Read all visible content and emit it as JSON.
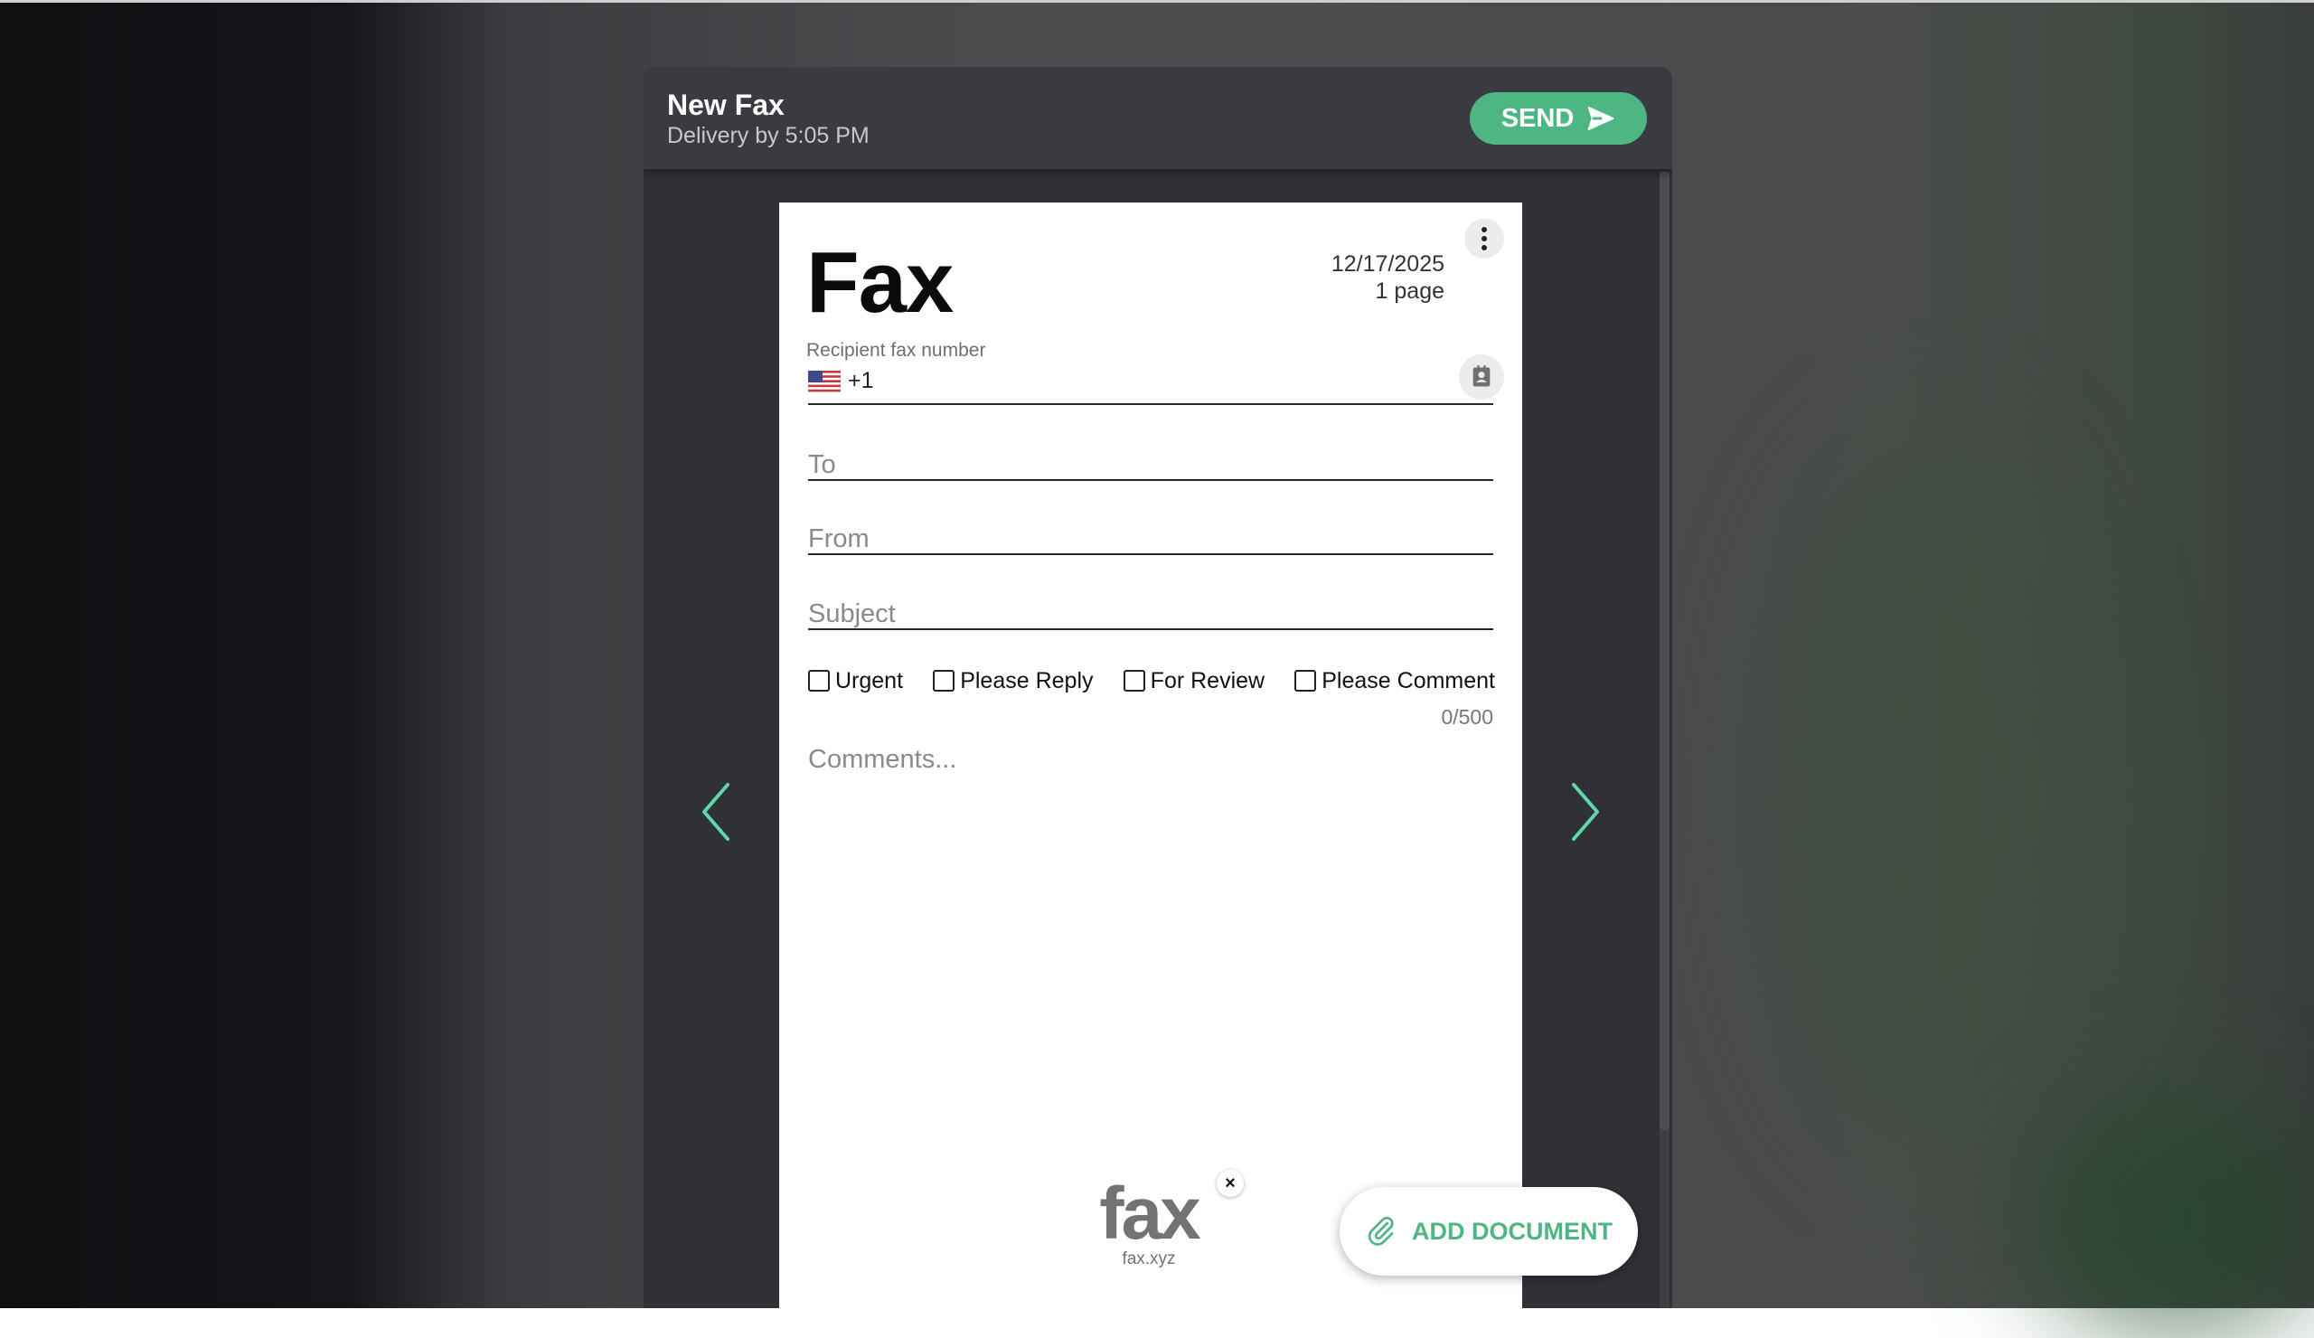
{
  "header": {
    "title": "New Fax",
    "subtitle": "Delivery by 5:05 PM",
    "send_label": "SEND"
  },
  "document": {
    "heading": "Fax",
    "date": "12/17/2025",
    "pages": "1 page",
    "recipient_label": "Recipient fax number",
    "country_code": "+1",
    "to_placeholder": "To",
    "from_placeholder": "From",
    "subject_placeholder": "Subject",
    "checkboxes": [
      "Urgent",
      "Please Reply",
      "For Review",
      "Please Comment"
    ],
    "char_counter": "0/500",
    "comments_placeholder": "Comments...",
    "logo_text": "fax",
    "logo_subtext": "fax.xyz",
    "logo_remove": "×"
  },
  "actions": {
    "add_document_label": "ADD DOCUMENT"
  },
  "colors": {
    "accent": "#4db683",
    "arrow": "#5fd6a4",
    "window_bg": "#2f3137",
    "titlebar_bg": "#393b41"
  },
  "icons": {
    "send": "send-icon",
    "prev": "chevron-left-icon",
    "next": "chevron-right-icon",
    "menu": "more-vertical-icon",
    "contacts": "contacts-icon",
    "flag": "us-flag-icon",
    "attach": "paperclip-icon",
    "close": "close-icon"
  }
}
